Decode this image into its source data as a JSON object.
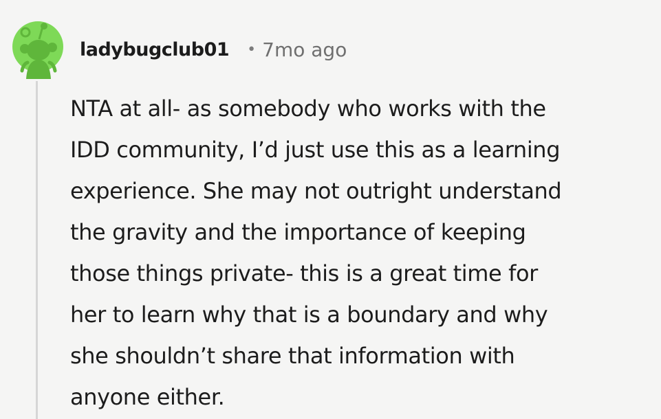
{
  "comment": {
    "username": "ladybugclub01",
    "separator": "•",
    "timestamp": "7mo ago",
    "avatar_icon": "snoo-avatar-icon",
    "avatar_color": "#7ed957",
    "body_lines": [
      "NTA at all- as somebody who works with the",
      "IDD community, I’d just use this as a learning",
      "experience. She may not outright understand",
      "the gravity and the importance of keeping",
      "those things private- this is a great time for",
      "her to learn why that is a boundary and why",
      "she shouldn’t share that information with",
      "anyone either."
    ]
  }
}
